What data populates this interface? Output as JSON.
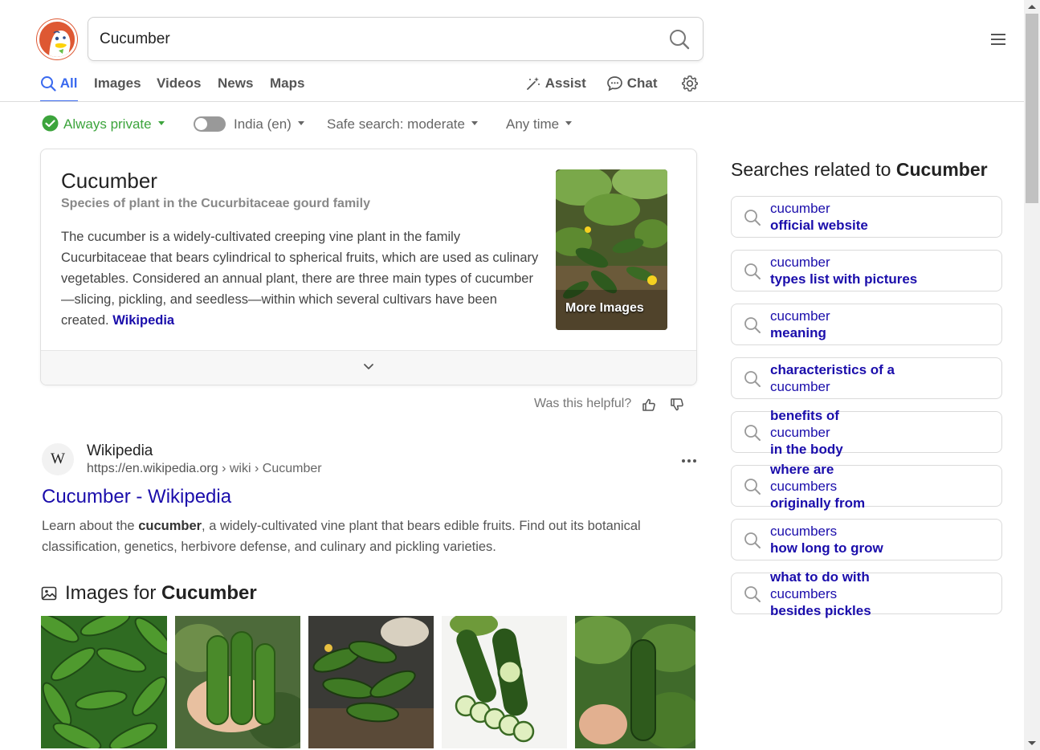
{
  "search": {
    "query": "Cucumber"
  },
  "nav": {
    "tabs": [
      {
        "label": "All"
      },
      {
        "label": "Images"
      },
      {
        "label": "Videos"
      },
      {
        "label": "News"
      },
      {
        "label": "Maps"
      }
    ],
    "assist_label": "Assist",
    "chat_label": "Chat"
  },
  "filters": {
    "private_label": "Always private",
    "region_label": "India (en)",
    "safe_search_label": "Safe search: moderate",
    "time_label": "Any time"
  },
  "knowledge_panel": {
    "title": "Cucumber",
    "subtitle": "Species of plant in the Cucurbitaceae gourd family",
    "description": "The cucumber is a widely-cultivated creeping vine plant in the family Cucurbitaceae that bears cylindrical to spherical fruits, which are used as culinary vegetables. Considered an annual plant, there are three main types of cucumber—slicing, pickling, and seedless—within which several cultivars have been created.",
    "source_link": "Wikipedia",
    "image_label": "More Images"
  },
  "feedback": {
    "question": "Was this helpful?"
  },
  "result": {
    "favicon_letter": "W",
    "site_name": "Wikipedia",
    "url_host": "https://en.wikipedia.org",
    "url_path": " › wiki › Cucumber",
    "title": "Cucumber - Wikipedia",
    "snippet_before": "Learn about the ",
    "snippet_bold": "cucumber",
    "snippet_after": ", a widely-cultivated vine plant that bears edible fruits. Find out its botanical classification, genetics, herbivore defense, and culinary and pickling varieties."
  },
  "images_section": {
    "prefix": "Images for ",
    "term": "Cucumber"
  },
  "related": {
    "title_prefix": "Searches related to ",
    "title_term": "Cucumber",
    "items": [
      {
        "parts": [
          {
            "t": "cucumber ",
            "b": false
          },
          {
            "t": "official website",
            "b": true
          }
        ]
      },
      {
        "parts": [
          {
            "t": "cucumber ",
            "b": false
          },
          {
            "t": "types list with pictures",
            "b": true
          }
        ]
      },
      {
        "parts": [
          {
            "t": "cucumber ",
            "b": false
          },
          {
            "t": "meaning",
            "b": true
          }
        ]
      },
      {
        "parts": [
          {
            "t": "characteristics of a ",
            "b": true
          },
          {
            "t": "cucumber",
            "b": false
          }
        ]
      },
      {
        "parts": [
          {
            "t": "benefits of ",
            "b": true
          },
          {
            "t": "cucumber",
            "b": false
          },
          {
            "t": " in the body",
            "b": true
          }
        ]
      },
      {
        "parts": [
          {
            "t": "where are ",
            "b": true
          },
          {
            "t": "cucumbers",
            "b": false
          },
          {
            "t": " originally from",
            "b": true
          }
        ]
      },
      {
        "parts": [
          {
            "t": "cucumbers ",
            "b": false
          },
          {
            "t": "how long to grow",
            "b": true
          }
        ]
      },
      {
        "parts": [
          {
            "t": "what to do with ",
            "b": true
          },
          {
            "t": "cucumbers",
            "b": false
          },
          {
            "t": " besides pickles",
            "b": true
          }
        ]
      }
    ]
  },
  "colors": {
    "accent": "#3969ef",
    "link": "#1a0dab",
    "brand": "#de5833",
    "private_green": "#3ca43c"
  },
  "icons": [
    "duckduckgo-logo",
    "search-icon",
    "hamburger-menu-icon",
    "magic-wand-icon",
    "chat-bubble-icon",
    "gear-icon",
    "check-circle-icon",
    "chevron-down-icon",
    "thumbs-up-icon",
    "thumbs-down-icon",
    "more-dots-icon",
    "image-icon"
  ]
}
